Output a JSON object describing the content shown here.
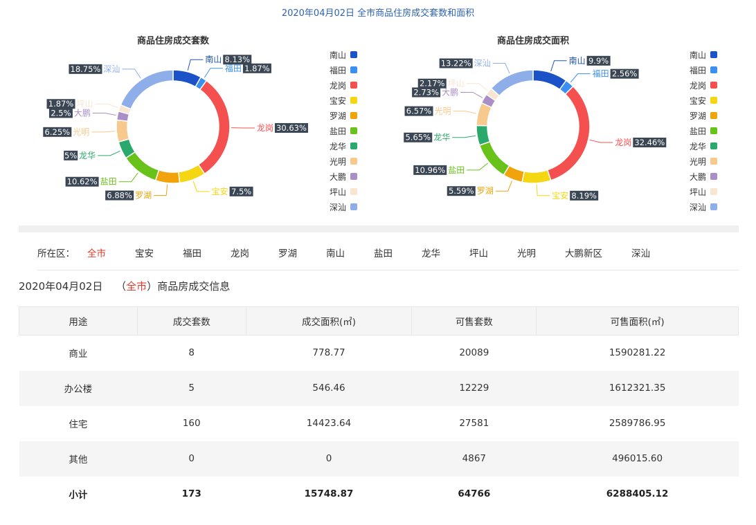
{
  "page_title": "2020年04月02日 全市商品住房成交套数和面积",
  "chart_data": [
    {
      "type": "pie",
      "title": "商品住房成交套数",
      "categories": [
        "南山",
        "福田",
        "龙岗",
        "宝安",
        "罗湖",
        "盐田",
        "龙华",
        "光明",
        "大鹏",
        "坪山",
        "深汕"
      ],
      "values": [
        8.13,
        1.87,
        30.63,
        7.5,
        6.88,
        10.62,
        5,
        6.25,
        2.5,
        1.87,
        18.75
      ],
      "value_labels": [
        "8.13%",
        "1.87%",
        "30.63%",
        "7.5%",
        "6.88%",
        "10.62%",
        "5%",
        "6.25%",
        "2.5%",
        "1.87%",
        "18.75%"
      ],
      "legend": [
        "南山",
        "福田",
        "龙岗",
        "宝安",
        "罗湖",
        "盐田",
        "龙华",
        "光明",
        "大鹏",
        "坪山",
        "深汕"
      ],
      "legend_position": "right"
    },
    {
      "type": "pie",
      "title": "商品住房成交面积",
      "categories": [
        "南山",
        "福田",
        "龙岗",
        "宝安",
        "罗湖",
        "盐田",
        "龙华",
        "光明",
        "大鹏",
        "坪山",
        "深汕"
      ],
      "values": [
        9.9,
        2.56,
        32.46,
        8.19,
        5.59,
        10.96,
        5.65,
        6.57,
        2.73,
        2.17,
        13.22
      ],
      "value_labels": [
        "9.9%",
        "2.56%",
        "32.46%",
        "8.19%",
        "5.59%",
        "10.96%",
        "5.65%",
        "6.57%",
        "2.73%",
        "2.17%",
        "13.22%"
      ],
      "legend": [
        "南山",
        "福田",
        "龙岗",
        "宝安",
        "罗湖",
        "盐田",
        "龙华",
        "光明",
        "大鹏",
        "坪山",
        "深汕"
      ],
      "legend_position": "right"
    }
  ],
  "colors": [
    "#1b52c8",
    "#3b8ff0",
    "#f55050",
    "#f5d613",
    "#f0a30a",
    "#69c21a",
    "#2ba86c",
    "#f8c98c",
    "#a98fc6",
    "#f8e6d0",
    "#8eaeea"
  ],
  "district_filter": {
    "label": "所在区：",
    "items": [
      "全市",
      "宝安",
      "福田",
      "龙岗",
      "罗湖",
      "南山",
      "盐田",
      "龙华",
      "坪山",
      "光明",
      "大鹏新区",
      "深汕"
    ],
    "active": "全市"
  },
  "info": {
    "date": "2020年04月02日",
    "open_paren": "（",
    "area": "全市",
    "close_paren": "）",
    "suffix": "商品房成交信息"
  },
  "table": {
    "headers": [
      "用途",
      "成交套数",
      "成交面积(㎡)",
      "可售套数",
      "可售面积(㎡)"
    ],
    "rows": [
      [
        "商业",
        "8",
        "778.77",
        "20089",
        "1590281.22"
      ],
      [
        "办公楼",
        "5",
        "546.46",
        "12229",
        "1612321.35"
      ],
      [
        "住宅",
        "160",
        "14423.64",
        "27581",
        "2589786.95"
      ],
      [
        "其他",
        "0",
        "0",
        "4867",
        "496015.60"
      ],
      [
        "小计",
        "173",
        "15748.87",
        "64766",
        "6288405.12"
      ]
    ]
  }
}
